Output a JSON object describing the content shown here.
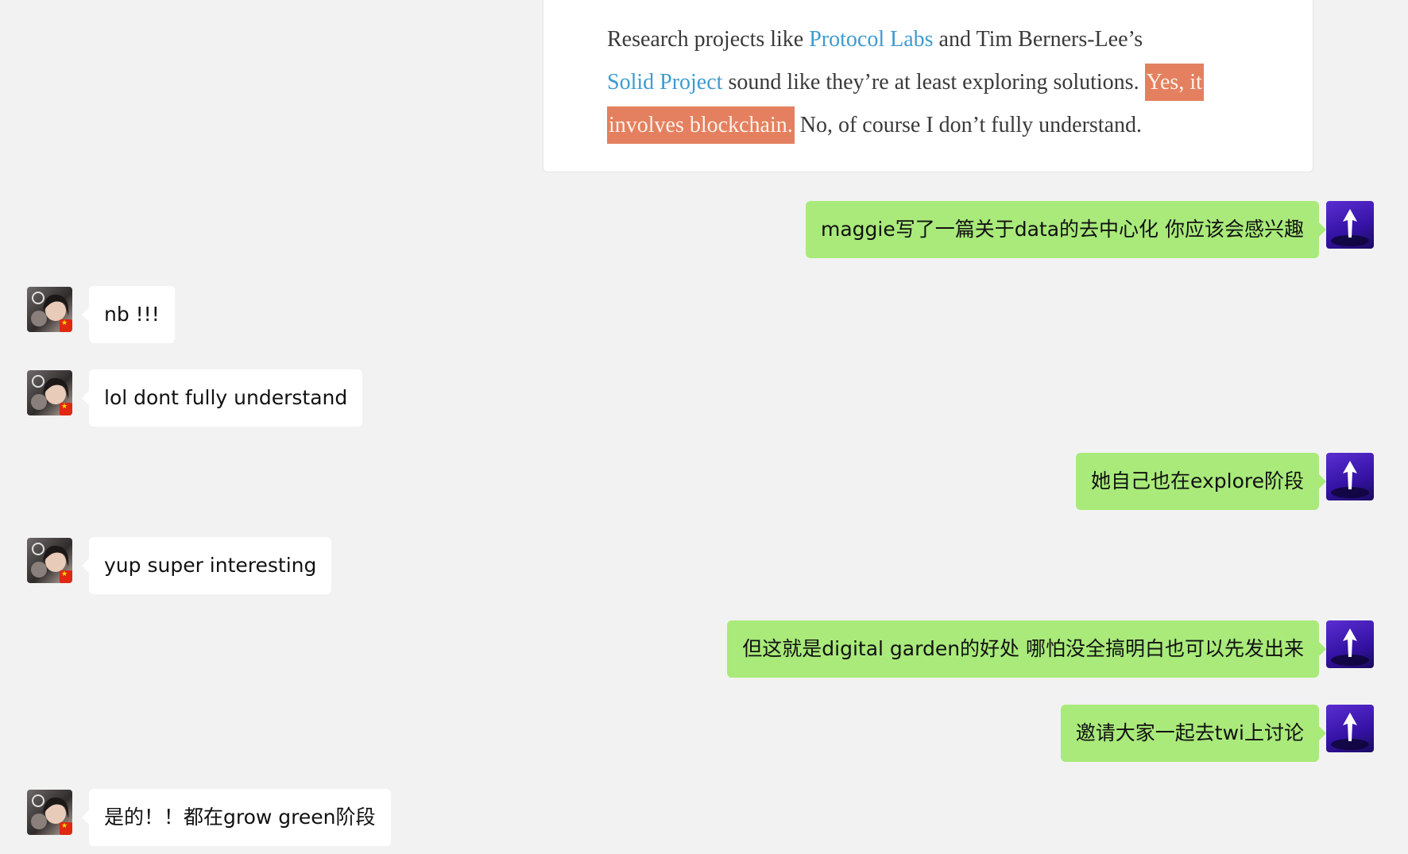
{
  "quote": {
    "line1_prefix": "Research projects like ",
    "link1": "Protocol Labs",
    "line1_suffix": " and Tim Berners-Lee’s",
    "link2": "Solid Project",
    "line2_mid": " sound like they’re at least exploring solutions. ",
    "highlight1": "Yes, it",
    "highlight2": "involves blockchain.",
    "line3_suffix": " No, of course I don’t fully understand."
  },
  "messages": [
    {
      "sender": "me",
      "text": "maggie写了一篇关于data的去中心化 你应该会感兴趣"
    },
    {
      "sender": "friend",
      "text": "nb !!!"
    },
    {
      "sender": "friend",
      "text": "lol dont fully understand"
    },
    {
      "sender": "me",
      "text": "她自己也在explore阶段"
    },
    {
      "sender": "friend",
      "text": "yup super interesting"
    },
    {
      "sender": "me",
      "text": "但这就是digital garden的好处 哪怕没全搞明白也可以先发出来"
    },
    {
      "sender": "me",
      "text": "邀请大家一起去twi上讨论"
    },
    {
      "sender": "friend",
      "text": "是的！！都在grow green阶段"
    }
  ],
  "icons": {
    "friend_avatar": "avatar-photo-icon",
    "friend_badge": "china-flag-icon",
    "my_avatar": "arrow-up-logo-icon"
  },
  "colors": {
    "background": "#f2f2f2",
    "incoming_bubble": "#ffffff",
    "outgoing_bubble": "#a9ea7a",
    "link": "#3d9bd1",
    "highlight": "#e4805f"
  }
}
